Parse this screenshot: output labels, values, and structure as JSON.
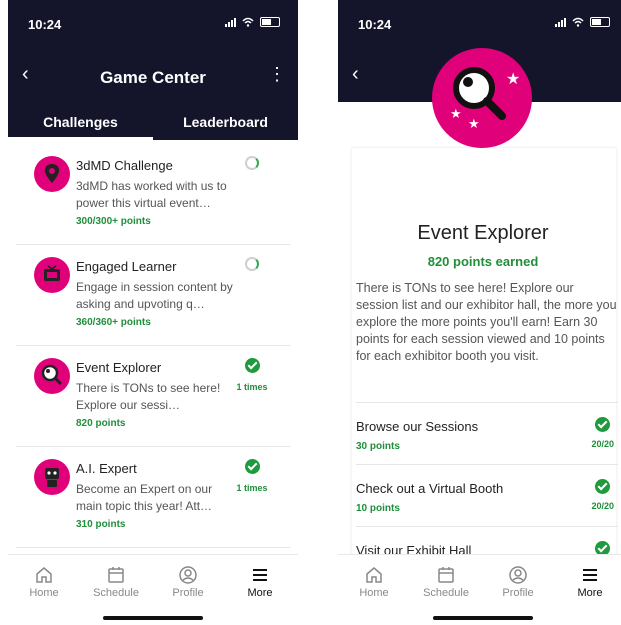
{
  "left": {
    "status_time": "10:24",
    "nav": {
      "back": "‹",
      "title": "Game Center",
      "menu": "⋮"
    },
    "tabs": [
      {
        "label": "Challenges"
      },
      {
        "label": "Leaderboard"
      }
    ],
    "cards": [
      {
        "title": "3dMD Challenge",
        "desc": "3dMD has worked with us to power this virtual event…",
        "points": "300/300+ points",
        "status": "in-progress",
        "icon": "map-pin-icon"
      },
      {
        "title": "Engaged Learner",
        "desc": "Engage in session content by asking and upvoting q…",
        "points": "360/360+ points",
        "status": "in-progress",
        "icon": "tv-icon"
      },
      {
        "title": "Event Explorer",
        "desc": "There is TONs to see here! Explore our sessi…",
        "points": "820 points",
        "status": "complete",
        "times": "1 times",
        "icon": "magnifier-icon"
      },
      {
        "title": "A.I. Expert",
        "desc": "Become an Expert on our main topic this year! Att…",
        "points": "310 points",
        "status": "complete",
        "times": "1 times",
        "icon": "robot-icon"
      }
    ]
  },
  "right": {
    "status_time": "10:24",
    "nav": {
      "back": "‹"
    },
    "title": "Event Explorer",
    "points_earned": "820 points earned",
    "description": "There is TONs to see here! Explore our session list and our exhibitor hall, the more you explore the more points you'll earn! Earn 30 points for each session viewed and 10 points for each exhibitor booth you visit.",
    "tasks": [
      {
        "label": "Browse our Sessions",
        "points": "30 points",
        "count": "20/20"
      },
      {
        "label": "Check out a Virtual Booth",
        "points": "10 points",
        "count": "20/20"
      },
      {
        "label": "Visit our Exhibit Hall",
        "points": "",
        "count": ""
      }
    ]
  },
  "bottom_nav": [
    {
      "label": "Home",
      "icon": "home-icon"
    },
    {
      "label": "Schedule",
      "icon": "calendar-icon"
    },
    {
      "label": "Profile",
      "icon": "profile-icon"
    },
    {
      "label": "More",
      "icon": "menu-icon",
      "active": true
    }
  ],
  "colors": {
    "navbar": "#14142b",
    "accent": "#e0007a",
    "success": "#1f8f3a"
  }
}
